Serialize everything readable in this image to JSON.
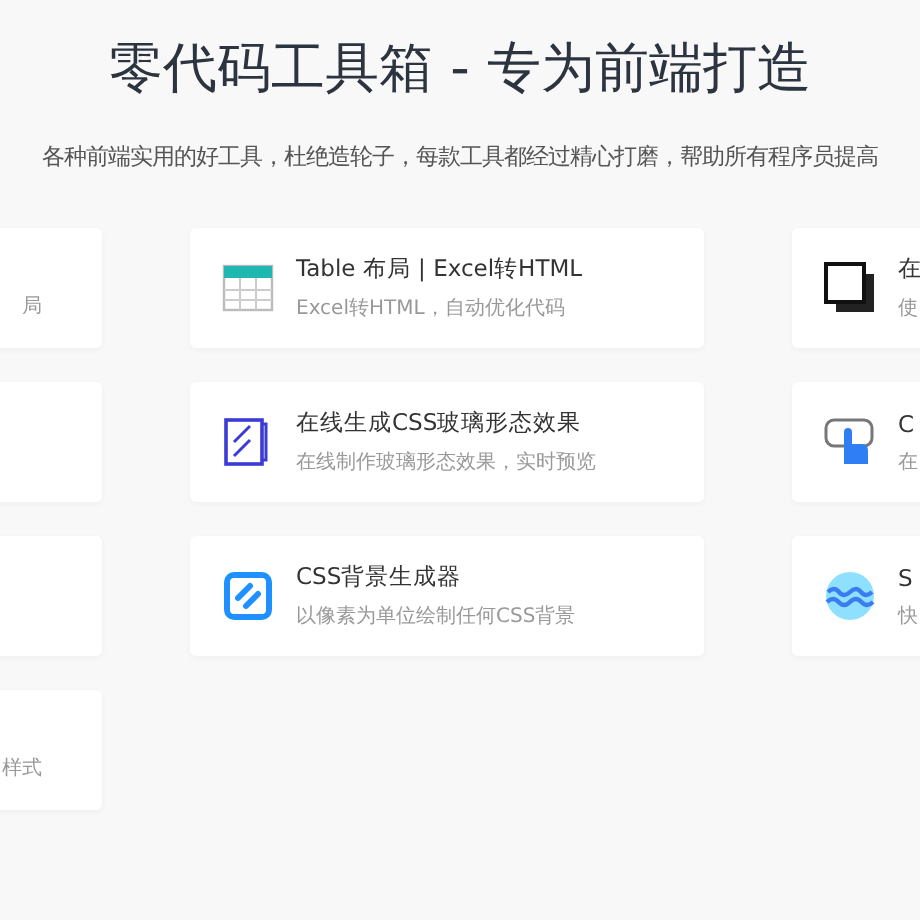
{
  "header": {
    "title": "零代码工具箱 - 专为前端打造",
    "subtitle": "各种前端实用的好工具，杜绝造轮子，每款工具都经过精心打磨，帮助所有程序员提高"
  },
  "rows": [
    {
      "cards": [
        {
          "kind": "text",
          "description": "局"
        },
        {
          "kind": "table",
          "title": "Table 布局 | Excel转HTML",
          "description": "Excel转HTML，自动优化代码"
        },
        {
          "kind": "layers",
          "title": "在",
          "description": "使"
        }
      ]
    },
    {
      "cards": [
        {
          "kind": "blank"
        },
        {
          "kind": "glass",
          "title": "在线生成CSS玻璃形态效果",
          "description": "在线制作玻璃形态效果，实时预览"
        },
        {
          "kind": "touch",
          "title": "C",
          "description": "在"
        }
      ]
    },
    {
      "cards": [
        {
          "kind": "blank"
        },
        {
          "kind": "pattern",
          "title": "CSS背景生成器",
          "description": "以像素为单位绘制任何CSS背景"
        },
        {
          "kind": "wave",
          "title": "S",
          "description": "快"
        }
      ]
    },
    {
      "cards": [
        {
          "kind": "text",
          "description": "样式"
        }
      ]
    }
  ]
}
